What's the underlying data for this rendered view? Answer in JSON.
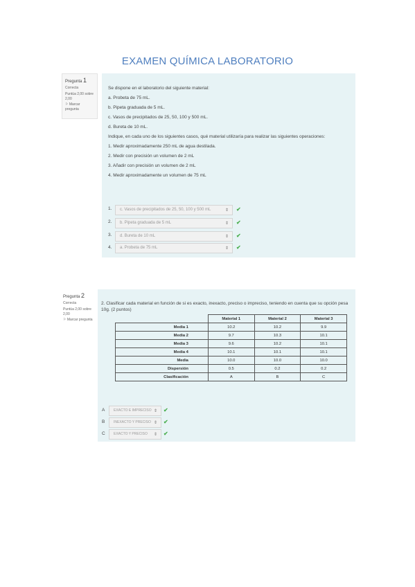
{
  "title": "EXAMEN QUÍMICA LABORATORIO",
  "q1": {
    "info": {
      "label": "Pregunta",
      "num": "1",
      "state": "Correcta",
      "score": "Puntúa 2,00 sobre 2,00",
      "flag": "Marcar pregunta"
    },
    "lines": [
      "Se dispone en el laboratorio del siguiente material:",
      "a. Probeta de 75 mL.",
      "b. Pipeta graduada de 5 mL.",
      "c. Vasos de precipitados de 25, 50, 100 y 500 mL.",
      "d. Bureta de 10 mL.",
      "Indique, en cada uno de los siguientes casos, qué material utilizaría para realizar las siguientes operaciones:",
      "1.   Medir aproximadamente 250 mL de agua destilada.",
      "2.   Medir con precisión un volumen de 2 mL",
      "3.   Añadir con precisión un volumen de 2 mL",
      "4.   Medir aproximadamente un volumen de 75 mL"
    ],
    "answers": [
      {
        "num": "1.",
        "text": "c. Vasos de precipitados de 25, 50, 100 y 500 mL"
      },
      {
        "num": "2.",
        "text": "b. Pipeta graduada de 5 mL"
      },
      {
        "num": "3.",
        "text": "d. Bureta de 10 mL"
      },
      {
        "num": "4.",
        "text": "a. Probeta de 75 mL"
      }
    ]
  },
  "q2": {
    "info": {
      "label": "Pregunta",
      "num": "2",
      "state": "Correcta",
      "score": "Puntúa 2,00 sobre 2,00",
      "flag": "Marcar pregunta"
    },
    "intro": "2. Clasificar cada material en función de si es exacto, inexacto, preciso o impreciso, teniendo en cuenta que su opción pesa 10g. (2 puntos)",
    "table": {
      "headers": [
        "",
        "Material 1",
        "Material 2",
        "Material 3"
      ],
      "rows": [
        [
          "Media 1",
          "10.2",
          "10.2",
          "9.9"
        ],
        [
          "Media 2",
          "9.7",
          "10.3",
          "10.1"
        ],
        [
          "Media 3",
          "9.6",
          "10.2",
          "10.1"
        ],
        [
          "Media 4",
          "10.1",
          "10.1",
          "10.1"
        ],
        [
          "Media",
          "10.0",
          "10.0",
          "10.0"
        ],
        [
          "Dispersión",
          "0.5",
          "0.2",
          "0.2"
        ],
        [
          "Clasificación",
          "A",
          "B",
          "C"
        ]
      ]
    },
    "answers": [
      {
        "num": "A",
        "text": "EXACTO E IMPRECISO"
      },
      {
        "num": "B",
        "text": "INEXACTO Y PRECISO"
      },
      {
        "num": "C",
        "text": "EXACTO Y PRECISO"
      }
    ]
  }
}
